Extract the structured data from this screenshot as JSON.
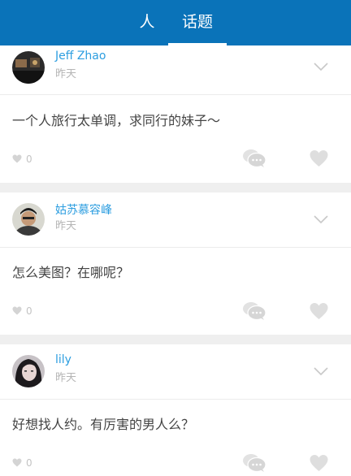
{
  "header": {
    "tabs": [
      {
        "label": "人"
      },
      {
        "label": "话题",
        "selected": true
      }
    ]
  },
  "colors": {
    "header_bg": "#0a73b9",
    "author_name": "#2d9ee0",
    "icon_gray": "#dddddd",
    "page_bg": "#efefef"
  },
  "posts": [
    {
      "author": "Jeff Zhao",
      "time": "昨天",
      "content": "一个人旅行太单调，求同行的妹子～",
      "likes": "0"
    },
    {
      "author": "姑苏慕容峰",
      "time": "昨天",
      "content": "怎么美图？在哪呢？",
      "likes": "0"
    },
    {
      "author": "lily",
      "time": "昨天",
      "content": "好想找人约。有厉害的男人么？",
      "likes": "0"
    }
  ],
  "icons": {
    "more": "chevron-down-icon",
    "comment": "comment-bubbles-icon",
    "like": "heart-icon"
  }
}
